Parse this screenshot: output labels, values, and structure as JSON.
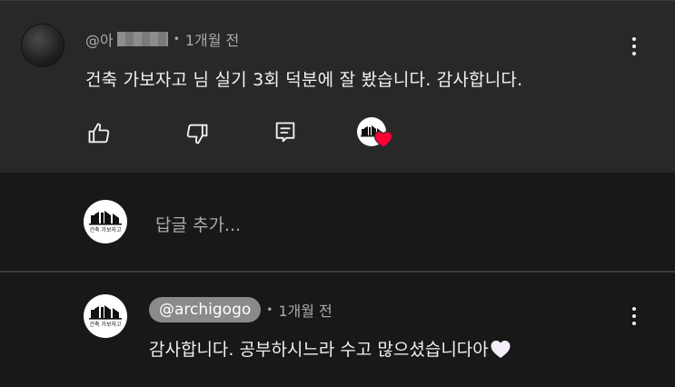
{
  "comment": {
    "handle": "@아",
    "time": "1개월 전",
    "text": "건축 가보자고 님 실기 3회 덕분에 잘 봤습니다. 감사합니다."
  },
  "logo": {
    "text": "건축 가보자고"
  },
  "reply_box": {
    "placeholder": "답글 추가..."
  },
  "reply": {
    "channel": "@archigogo",
    "time": "1개월 전",
    "text": "감사합니다. 공부하시느라 수고 많으셨습니다아"
  },
  "icons": {
    "like": "thumbs-up-icon",
    "dislike": "thumbs-down-icon",
    "reply": "reply-icon",
    "creator_heart": "creator-heart-icon",
    "menu": "more-vertical-icon"
  },
  "colors": {
    "background": "#181818",
    "card": "#282828",
    "text": "#f1f1f1",
    "secondary_text": "#aaaaaa",
    "heart": "#ff0033",
    "channel_pill": "#8a8a8a"
  }
}
